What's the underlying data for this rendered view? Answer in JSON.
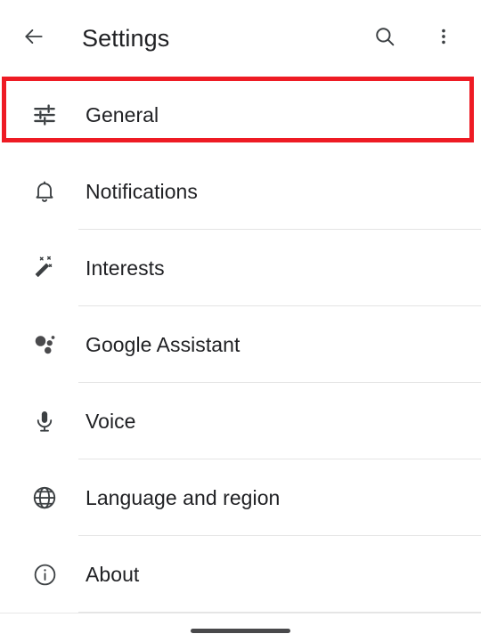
{
  "appbar": {
    "title": "Settings",
    "back_icon": "back-arrow-icon",
    "search_icon": "search-icon",
    "overflow_icon": "more-vert-icon"
  },
  "settings_list": {
    "items": [
      {
        "label": "General",
        "icon": "tune-icon",
        "highlighted": true,
        "divider": false
      },
      {
        "label": "Notifications",
        "icon": "bell-icon",
        "highlighted": false,
        "divider": true
      },
      {
        "label": "Interests",
        "icon": "magic-wand-icon",
        "highlighted": false,
        "divider": true
      },
      {
        "label": "Google Assistant",
        "icon": "assistant-icon",
        "highlighted": false,
        "divider": true
      },
      {
        "label": "Voice",
        "icon": "microphone-icon",
        "highlighted": false,
        "divider": true
      },
      {
        "label": "Language and region",
        "icon": "globe-icon",
        "highlighted": false,
        "divider": true
      },
      {
        "label": "About",
        "icon": "info-icon",
        "highlighted": false,
        "divider": true
      }
    ]
  },
  "annotation": {
    "target": "General",
    "color": "#ee1b24"
  },
  "navbar": {
    "home_indicator": "home-pill"
  },
  "colors": {
    "background": "#ffffff",
    "text_primary": "#202124",
    "icon": "#5f6368",
    "divider": "#e4e4e4",
    "annotation_red": "#ee1b24"
  }
}
